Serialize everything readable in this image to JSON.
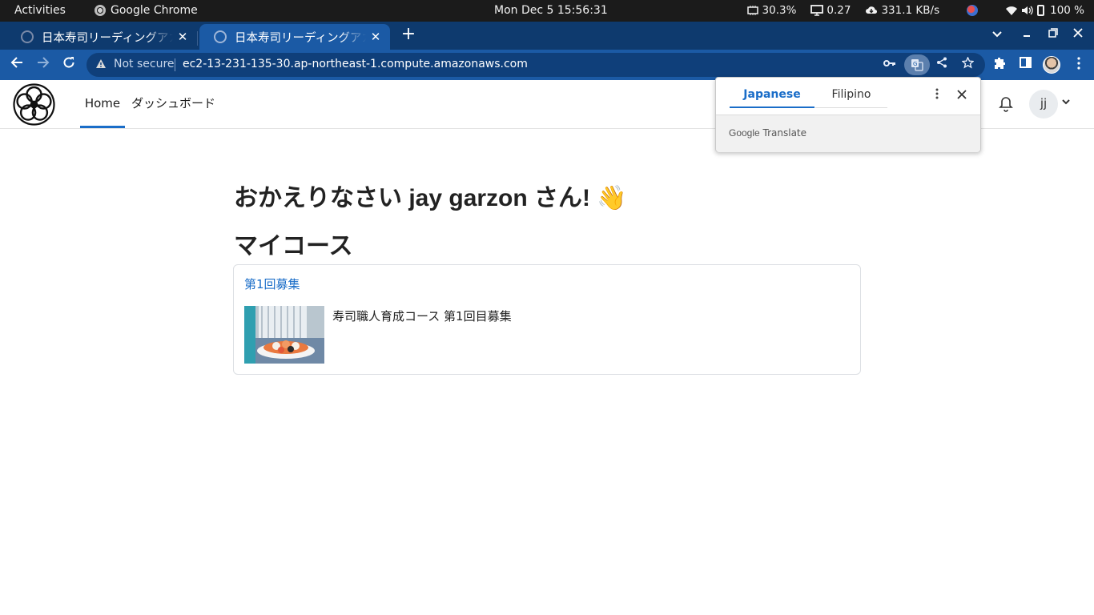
{
  "os_bar": {
    "activities": "Activities",
    "app_name": "Google Chrome",
    "clock": "Mon Dec 5  15:56:31",
    "cpu": "30.3%",
    "load": "0.27",
    "network": "331.1 KB/s",
    "battery": "100 %"
  },
  "browser": {
    "tabs": [
      {
        "title": "日本寿司リーディングアカ",
        "close": "✕"
      },
      {
        "title": "日本寿司リーディングアカ",
        "close": "✕"
      }
    ],
    "new_tab": "+",
    "not_secure": "Not secure",
    "url": "ec2-13-231-135-30.ap-northeast-1.compute.amazonaws.com"
  },
  "site": {
    "nav": {
      "home": "Home",
      "dashboard": "ダッシュボード"
    },
    "user_initials": "jj"
  },
  "main": {
    "welcome": "おかえりなさい jay garzon さん! 👋",
    "section_title": "マイコース",
    "course": {
      "cohort": "第1回募集",
      "title": "寿司職人育成コース 第1回目募集"
    }
  },
  "translate_popup": {
    "source_lang": "Japanese",
    "target_lang": "Filipino",
    "brand_google": "Google",
    "brand_translate": "Translate"
  },
  "colors": {
    "accent": "#1a6dc8",
    "chrome_frame": "#0e3a6e",
    "chrome_toolbar": "#1b5aa5",
    "os_bar": "#1b1b1b"
  }
}
